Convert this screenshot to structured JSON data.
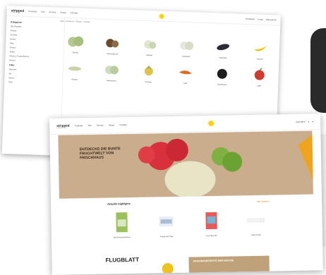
{
  "brand": {
    "logo": "stripped",
    "tagline": "Fruits & Veg"
  },
  "colors": {
    "accent": "#ffd200",
    "hero_bg": "#c9ad8d",
    "link": "#d08a00",
    "text": "#222222"
  },
  "back_screen": {
    "nav": [
      "Produkte",
      "Info",
      "Service",
      "Shops",
      "Kontakt"
    ],
    "header_right": [
      "Anmelden",
      "Konto",
      "Warenkorb"
    ],
    "breadcrumb": "Start > Sortiment > Exoten > Früchte",
    "sidebar": {
      "title": "Kategorien",
      "items": [
        "Alle Produkte",
        "Früchte",
        "Gemüse",
        "Exoten",
        "Pilze",
        "Kräuter",
        "Salate",
        "Nüsse & Trockenfrüchte",
        "Beeren"
      ],
      "filter_title": "Filter",
      "filters": [
        "Herkunft",
        "Bio",
        "Saison",
        "Preis"
      ]
    },
    "products": [
      {
        "name": "Kiwano",
        "icon": "melon-icon"
      },
      {
        "name": "Passionsfrucht",
        "icon": "passionfruit-icon"
      },
      {
        "name": "Kohlrabi",
        "icon": "kohlrabi-icon"
      },
      {
        "name": "Knoblauch",
        "icon": "garlic-icon"
      },
      {
        "name": "Aubergine",
        "icon": "eggplant-icon"
      },
      {
        "name": "Banane",
        "icon": "banana-icon"
      },
      {
        "name": "Chayote",
        "icon": "chayote-icon"
      },
      {
        "name": "Babyananas",
        "icon": "pineapple-icon"
      },
      {
        "name": "Physalis",
        "icon": "physalis-icon"
      },
      {
        "name": "Chili",
        "icon": "chili-icon"
      },
      {
        "name": "Brombeeren",
        "icon": "blackberry-icon"
      },
      {
        "name": "Apfel",
        "icon": "apple-icon"
      }
    ]
  },
  "front_screen": {
    "nav": [
      "Produkte",
      "Info",
      "Service",
      "Shops",
      "Kontakt"
    ],
    "header_right": [
      "Anmelden"
    ],
    "hero": {
      "headline": "ENTDECKE DIE BUNTE FRUCHTWELT VON FRISCHHAUS"
    },
    "section": {
      "title": "Aktuelle Highlights",
      "link": "Alle ansehen"
    },
    "products": [
      {
        "name": "Bio Gemüsemischung",
        "icon": "package-icon"
      },
      {
        "name": "Kokosnuss Chips",
        "icon": "snack-icon"
      },
      {
        "name": "Frucht Box Mix",
        "icon": "box-icon"
      },
      {
        "name": "Dattel Snack",
        "icon": "bar-icon"
      }
    ],
    "flyer": {
      "label": "FLUGBLATT",
      "banner": "SAISONANGEBOTE DER WOCHE"
    }
  }
}
